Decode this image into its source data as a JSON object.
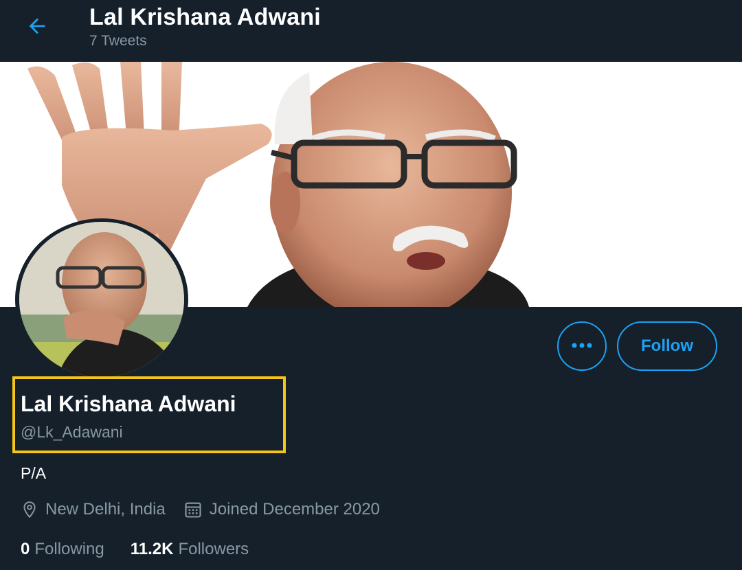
{
  "header": {
    "title": "Lal Krishana Adwani",
    "subtitle": "7 Tweets",
    "back_icon": "arrow-left-icon"
  },
  "profile": {
    "display_name": "Lal Krishana Adwani",
    "handle": "@Lk_Adawani",
    "bio": "P/A",
    "location": "New Delhi, India",
    "joined": "Joined December 2020",
    "following_count": "0",
    "following_label": "Following",
    "followers_count": "11.2K",
    "followers_label": "Followers"
  },
  "actions": {
    "more_icon": "more-horizontal-icon",
    "follow_label": "Follow"
  },
  "colors": {
    "background": "#15202b",
    "accent": "#1da1f2",
    "secondary_text": "#8899a6",
    "highlight": "#f5c518"
  }
}
